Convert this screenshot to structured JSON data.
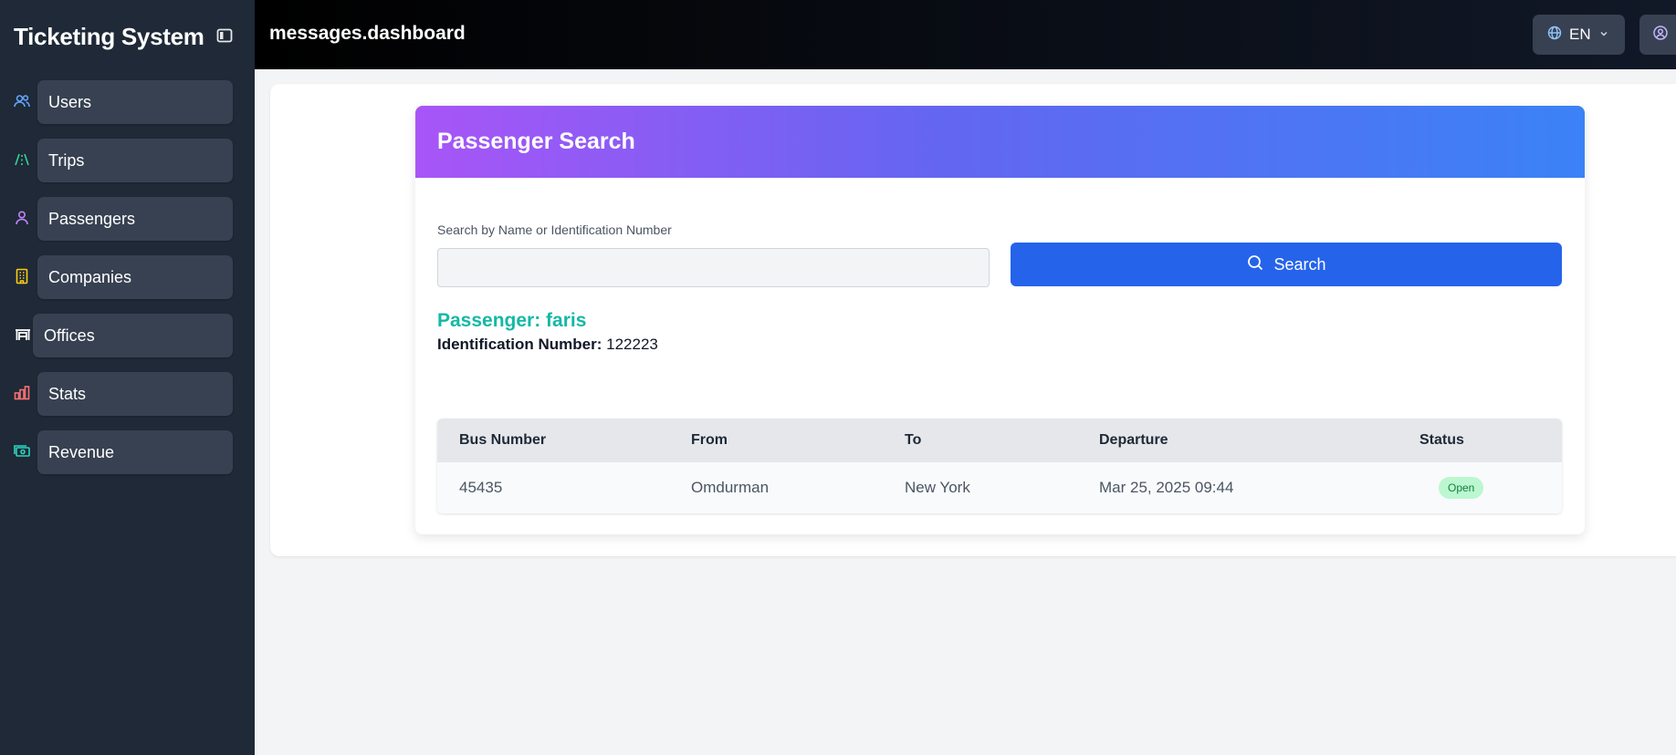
{
  "sidebar": {
    "brand": "Ticketing System",
    "items": [
      {
        "label": "Users",
        "icon": "users-icon",
        "color": "#60a5fa"
      },
      {
        "label": "Trips",
        "icon": "route-icon",
        "color": "#34d399"
      },
      {
        "label": "Passengers",
        "icon": "user-icon",
        "color": "#c084fc"
      },
      {
        "label": "Companies",
        "icon": "building-icon",
        "color": "#facc15"
      },
      {
        "label": "Offices",
        "icon": "office-icon",
        "color": "#ffffff"
      },
      {
        "label": "Stats",
        "icon": "bar-chart-icon",
        "color": "#f87171"
      },
      {
        "label": "Revenue",
        "icon": "money-icon",
        "color": "#2dd4bf"
      }
    ]
  },
  "topbar": {
    "title": "messages.dashboard",
    "language": "EN"
  },
  "card": {
    "title": "Passenger Search",
    "search_label": "Search by Name or Identification Number",
    "search_value": "",
    "search_button": "Search",
    "passenger_heading": "Passenger: faris",
    "id_label": "Identification Number:",
    "id_value": "122223"
  },
  "table": {
    "headers": [
      "Bus Number",
      "From",
      "To",
      "Departure",
      "Status"
    ],
    "rows": [
      {
        "bus_number": "45435",
        "from": "Omdurman",
        "to": "New York",
        "departure": "Mar 25, 2025 09:44",
        "status": "Open"
      }
    ]
  },
  "colors": {
    "sidebar_bg": "#1f2937",
    "accent_blue": "#2563eb",
    "passenger_teal": "#14b8a6",
    "status_open": "#bbf7d0"
  }
}
